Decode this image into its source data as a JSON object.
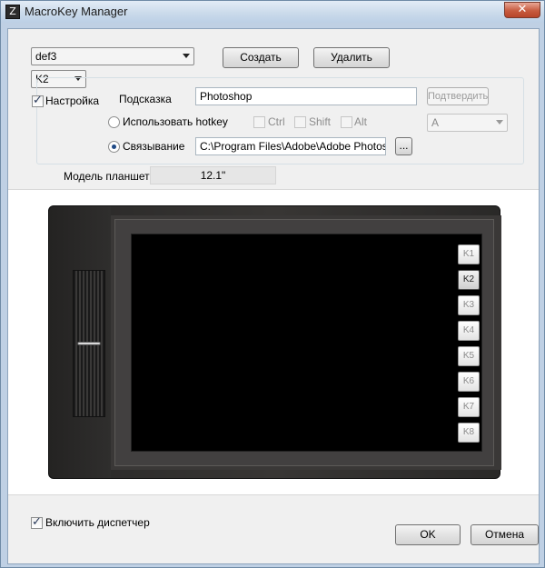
{
  "window": {
    "title": "MacroKey Manager",
    "close": "✕"
  },
  "profile": {
    "value": "def3"
  },
  "buttons": {
    "create": "Создать",
    "delete": "Удалить",
    "confirm": "Подтвердить",
    "browse": "...",
    "ok": "OK",
    "cancel": "Отмена"
  },
  "key_select": {
    "value": "K2"
  },
  "settings": {
    "label": "Настройка",
    "checked": true
  },
  "hint": {
    "label": "Подсказка",
    "value": "Photoshop"
  },
  "hotkey": {
    "label": "Использовать hotkey",
    "ctrl": "Ctrl",
    "shift": "Shift",
    "alt": "Alt",
    "key_value": "A"
  },
  "binding": {
    "label": "Связывание",
    "path": "C:\\Program Files\\Adobe\\Adobe Photoshop"
  },
  "tablet": {
    "model_label": "Модель планшета",
    "model_value": "12.1\"",
    "keys": [
      "K1",
      "K2",
      "K3",
      "K4",
      "K5",
      "K6",
      "K7",
      "K8"
    ],
    "active_key": "K2"
  },
  "enable_manager": {
    "label": "Включить диспетчер",
    "checked": true
  }
}
